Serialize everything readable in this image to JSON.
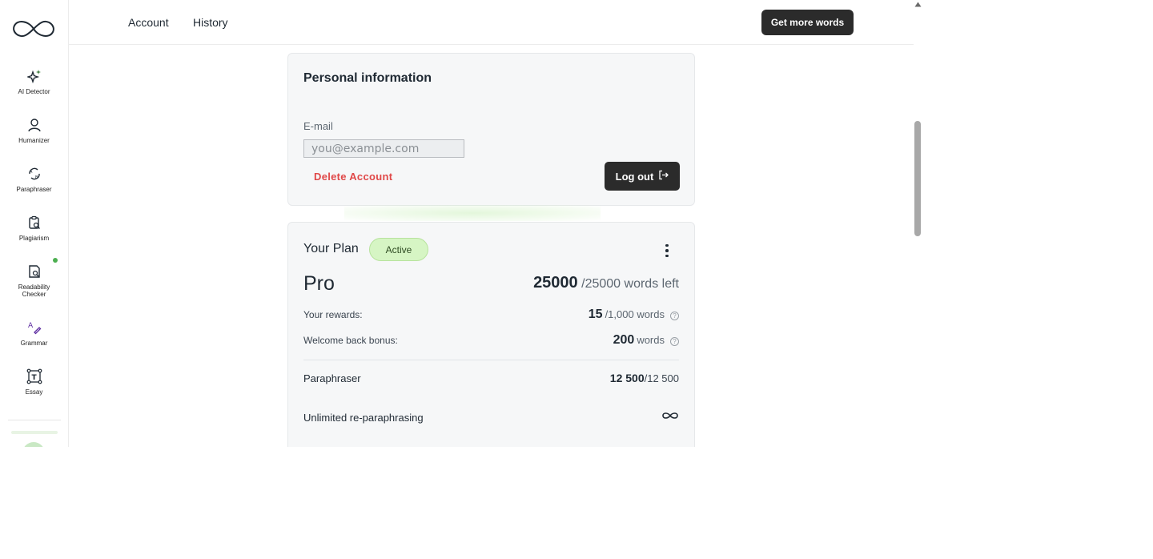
{
  "sidebar": {
    "logo": "infinity-logo",
    "items": [
      {
        "label": "AI Detector",
        "icon": "sparkle-icon"
      },
      {
        "label": "Humanizer",
        "icon": "person-icon"
      },
      {
        "label": "Paraphraser",
        "icon": "paraphrase-icon"
      },
      {
        "label": "Plagiarism",
        "icon": "clipboard-search-icon"
      },
      {
        "label": "Readability Checker",
        "icon": "doc-search-icon"
      },
      {
        "label": "Grammar",
        "icon": "grammar-icon"
      },
      {
        "label": "Essay",
        "icon": "text-frame-icon"
      }
    ]
  },
  "topbar": {
    "tabs": [
      "Account",
      "History"
    ],
    "cta": "Get more words"
  },
  "personal": {
    "title": "Personal information",
    "email_label": "E-mail",
    "email_placeholder": "you@example.com",
    "delete_label": "Delete Account",
    "logout_label": "Log out"
  },
  "plan": {
    "title": "Your Plan",
    "status": "Active",
    "name": "Pro",
    "words_remaining": "25000",
    "words_total": "/25000 words left",
    "rewards": {
      "label": "Your rewards:",
      "value": "15",
      "suffix": "/1,000 words"
    },
    "bonus": {
      "label": "Welcome back bonus:",
      "value": "200",
      "suffix": "words"
    },
    "features": [
      {
        "label": "Paraphraser",
        "value": "12 500",
        "suffix": "/12 500"
      },
      {
        "label": "Unlimited re-paraphrasing",
        "value_icon": "infinity-icon"
      }
    ]
  },
  "colors": {
    "accent_dark": "#2b2b2b",
    "danger": "#e04848",
    "active_badge": "#d6f5c4",
    "new_dot": "#4caf50"
  }
}
